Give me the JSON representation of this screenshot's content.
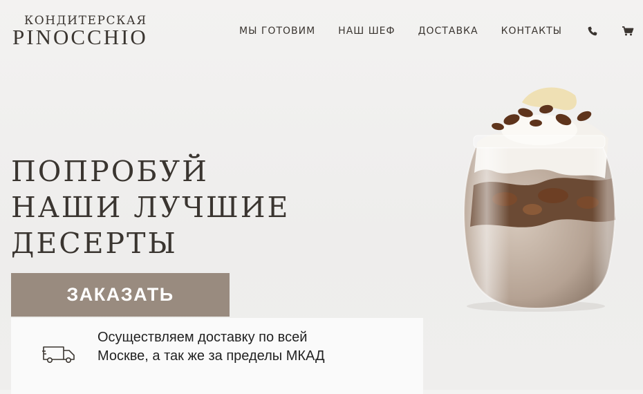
{
  "logo": {
    "top_line": "КОНДИТЕРСКАЯ",
    "main": "PINOCCHIO"
  },
  "nav": {
    "items": [
      {
        "label": "МЫ ГОТОВИМ"
      },
      {
        "label": "НАШ ШЕФ"
      },
      {
        "label": "ДОСТАВКА"
      },
      {
        "label": "КОНТАКТЫ"
      }
    ],
    "phone_icon": "phone-icon",
    "cart_icon": "cart-icon"
  },
  "hero": {
    "title_lines": [
      "ПОПРОБУЙ",
      "НАШИ ЛУЧШИЕ",
      "ДЕСЕРТЫ"
    ],
    "order_button": "ЗАКАЗАТЬ"
  },
  "delivery": {
    "icon": "truck-icon",
    "text": "Осуществляем доставку по всей Москве, а так же за пределы МКАД"
  },
  "colors": {
    "text": "#3a3530",
    "button_bg": "#998b7f",
    "button_text": "#ffffff",
    "card_bg": "#fafafa",
    "page_bg": "#f1f0ef"
  }
}
